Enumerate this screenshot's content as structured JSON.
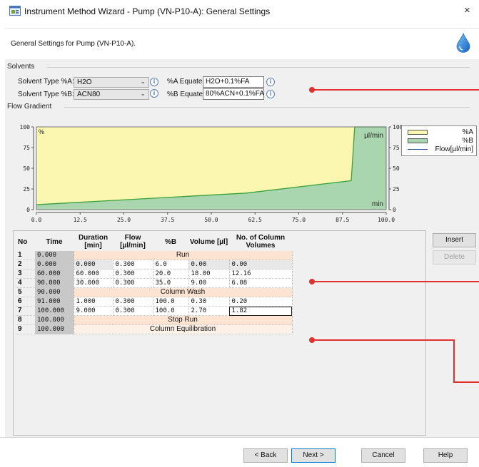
{
  "window": {
    "title": "Instrument Method Wizard - Pump (VN-P10-A): General Settings",
    "close": "×",
    "icon": "method-wizard-icon"
  },
  "header": {
    "description": "General Settings for Pump (VN-P10-A).",
    "icon": "solvent-drop-icon"
  },
  "solvents": {
    "group_label": "Solvents",
    "type_a_label": "Solvent Type %A:",
    "type_a_value": "H2O",
    "type_b_label": "Solvent Type %B:",
    "type_b_value": "ACN80",
    "equate_a_label": "%A Equate:",
    "equate_a_value": "H2O+0.1%FA",
    "equate_b_label": "%B Equate:",
    "equate_b_value": "80%ACN+0.1%FA"
  },
  "gradient": {
    "group_label": "Flow Gradient",
    "legend": [
      "%A",
      "%B",
      "Flow[µl/min]"
    ],
    "colors": {
      "a_fill": "#fbf7b1",
      "b_fill": "#a9d6ae",
      "flow_line": "#2f4fa0"
    }
  },
  "chart_data": {
    "type": "area",
    "left_axis_unit": "%",
    "right_axis_unit": "µl/min",
    "x_unit": "min",
    "xlim": [
      0,
      100
    ],
    "ylim": [
      0,
      100
    ],
    "x_ticks": [
      "0.0",
      "12.5",
      "25.0",
      "37.5",
      "50.0",
      "62.5",
      "75.0",
      "87.5",
      "100.0"
    ],
    "y_ticks": [
      "0",
      "25",
      "50",
      "75",
      "100"
    ],
    "y2_ticks": [
      "0",
      "25",
      "50",
      "75",
      "100"
    ],
    "series": [
      {
        "name": "%B",
        "x": [
          0,
          60,
          90,
          91,
          100
        ],
        "y": [
          6,
          20,
          35,
          100,
          100
        ]
      }
    ],
    "legend_position": "right"
  },
  "table": {
    "headers": [
      "No",
      "Time",
      "Duration [min]",
      "Flow [µl/min]",
      "%B",
      "Volume [µl]",
      "No. of Column Volumes"
    ],
    "rows": [
      {
        "no": "1",
        "time": "0.000",
        "merged": "Run"
      },
      {
        "no": "2",
        "time": "0.000",
        "cells": [
          "0.000",
          "0.300",
          "6.0",
          "0.00",
          "0.00"
        ]
      },
      {
        "no": "3",
        "time": "60.000",
        "cells": [
          "60.000",
          "0.300",
          "20.0",
          "18.00",
          "12.16"
        ]
      },
      {
        "no": "4",
        "time": "90.000",
        "cells": [
          "30.000",
          "0.300",
          "35.0",
          "9.00",
          "6.08"
        ]
      },
      {
        "no": "5",
        "time": "90.000",
        "merged": "Column Wash"
      },
      {
        "no": "6",
        "time": "91.000",
        "cells": [
          "1.000",
          "0.300",
          "100.0",
          "0.30",
          "0.20"
        ]
      },
      {
        "no": "7",
        "time": "100.000",
        "cells": [
          "9.000",
          "0.300",
          "100.0",
          "2.70",
          "1.82"
        ]
      },
      {
        "no": "8",
        "time": "100.000",
        "merged": "Stop Run"
      },
      {
        "no": "9",
        "time": "100.000",
        "merged": "Column Equilibration"
      }
    ],
    "selected_row": "7",
    "merged_fill": "#fde4d2"
  },
  "side_buttons": {
    "insert": "Insert",
    "delete": "Delete"
  },
  "footer": {
    "back": "< Back",
    "next": "Next >",
    "cancel": "Cancel",
    "help": "Help"
  }
}
